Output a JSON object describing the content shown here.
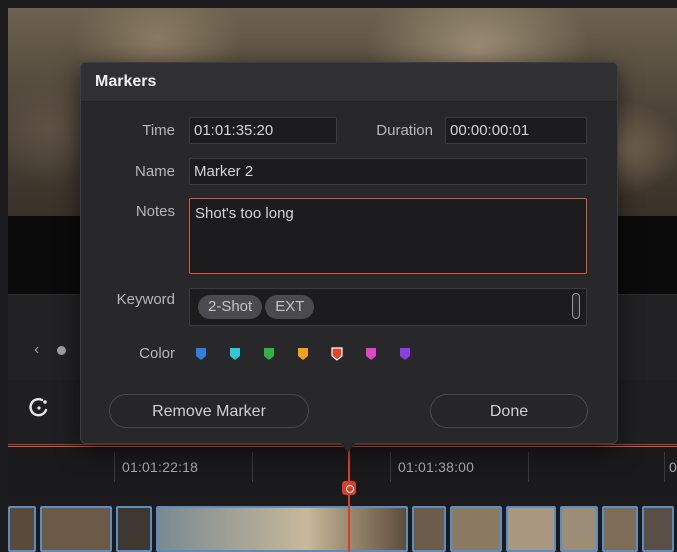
{
  "dialog": {
    "title": "Markers",
    "time_label": "Time",
    "time_value": "01:01:35:20",
    "duration_label": "Duration",
    "duration_value": "00:00:00:01",
    "name_label": "Name",
    "name_value": "Marker 2",
    "notes_label": "Notes",
    "notes_value": "Shot's too long",
    "keyword_label": "Keyword",
    "keywords": [
      "2-Shot",
      "EXT"
    ],
    "color_label": "Color",
    "colors": [
      {
        "name": "blue",
        "hex": "#2f7fe0"
      },
      {
        "name": "cyan",
        "hex": "#2ec9d6"
      },
      {
        "name": "green",
        "hex": "#2fb34a"
      },
      {
        "name": "yellow",
        "hex": "#f0a21e"
      },
      {
        "name": "red",
        "hex": "#e0442a",
        "selected": true
      },
      {
        "name": "pink",
        "hex": "#e046c8"
      },
      {
        "name": "purple",
        "hex": "#8a3ee6"
      }
    ],
    "remove_button": "Remove Marker",
    "done_button": "Done"
  },
  "timeline": {
    "timecodes": [
      "01:01:22:18",
      "01:01:38:00",
      "0"
    ]
  },
  "accent_color": "#d6402a"
}
